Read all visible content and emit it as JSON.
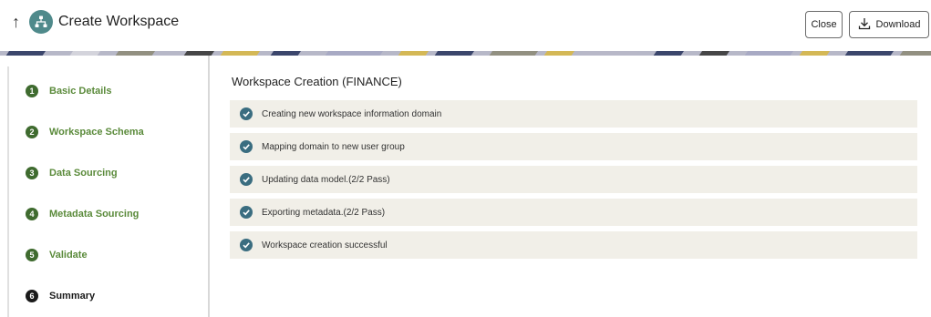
{
  "header": {
    "back_arrow": "↑",
    "app_icon": "workspace-hierarchy-icon",
    "title": "Create Workspace",
    "close_label": "Close",
    "download_label": "Download",
    "download_icon": "download-icon"
  },
  "steps": [
    {
      "number": "1",
      "label": "Basic Details",
      "state": "completed"
    },
    {
      "number": "2",
      "label": "Workspace Schema",
      "state": "completed"
    },
    {
      "number": "3",
      "label": "Data Sourcing",
      "state": "completed"
    },
    {
      "number": "4",
      "label": "Metadata Sourcing",
      "state": "completed"
    },
    {
      "number": "5",
      "label": "Validate",
      "state": "completed"
    },
    {
      "number": "6",
      "label": "Summary",
      "state": "current"
    }
  ],
  "main": {
    "title": "Workspace Creation (FINANCE)",
    "statuses": [
      {
        "text": "Creating new workspace information domain",
        "icon": "check-circle-icon"
      },
      {
        "text": "Mapping domain to new user group",
        "icon": "check-circle-icon"
      },
      {
        "text": "Updating data model.(2/2 Pass)",
        "icon": "check-circle-icon"
      },
      {
        "text": "Exporting metadata.(2/2 Pass)",
        "icon": "check-circle-icon"
      },
      {
        "text": "Workspace creation successful",
        "icon": "check-circle-icon"
      }
    ]
  },
  "colors": {
    "step_completed": "#3f6b2f",
    "step_label_completed": "#5a8a3a",
    "step_current": "#1a1a1a",
    "status_row_bg": "#f1efe8",
    "check_icon": "#3a6d80",
    "app_icon_bg": "#4f8a8b"
  }
}
